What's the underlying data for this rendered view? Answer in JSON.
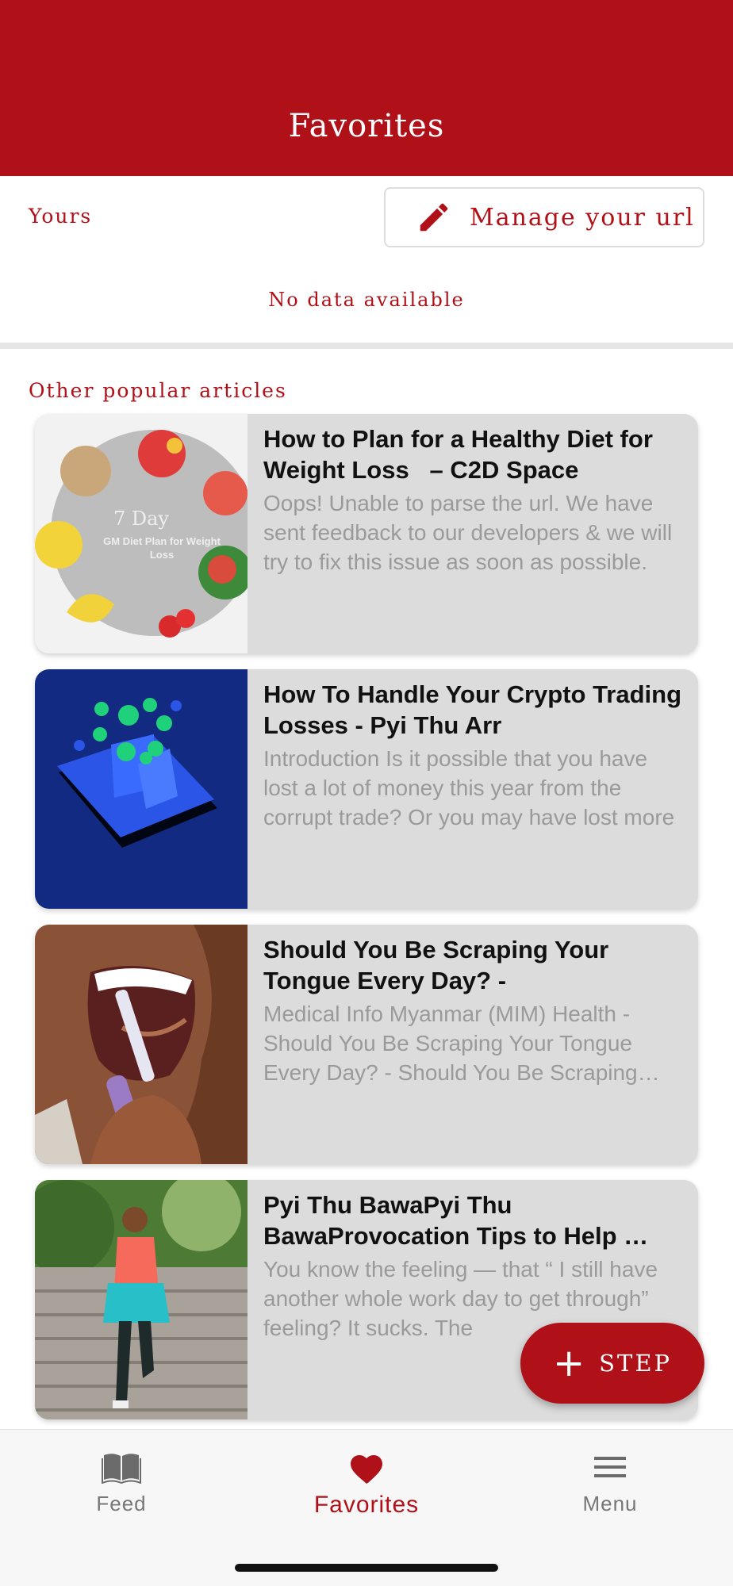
{
  "header": {
    "title": "Favorites"
  },
  "yours": {
    "label": "Yours",
    "manage_label": "Manage your url",
    "empty_text": "No data available"
  },
  "popular": {
    "label": "Other popular articles",
    "articles": [
      {
        "title": "How to Plan for a Healthy Diet for Weight Loss   – C2D Space",
        "description": "Oops! Unable to parse the url. We have sent feedback to our developers & we will try to fix this issue as soon as possible.",
        "thumb_text": "7 Day",
        "thumb_subtext": "GM Diet Plan for Weight Loss"
      },
      {
        "title": "How To Handle Your Crypto Trading Losses - Pyi Thu Arr",
        "description": "Introduction Is it possible that you have lost a lot of money this year from the corrupt trade? Or you may have lost more"
      },
      {
        "title": "Should You Be Scraping Your Tongue Every Day? -",
        "description": "Medical Info Myanmar (MIM) Health - Should You Be Scraping Your Tongue Every Day? - Should You Be Scraping Your Tongue"
      },
      {
        "title": "Pyi Thu BawaPyi Thu BawaProvocation Tips to Help …",
        "description": "You know the feeling — that “ I still have another whole work day to get through” feeling? It sucks. The"
      }
    ]
  },
  "fab": {
    "label": "STEP"
  },
  "tabs": [
    {
      "label": "Feed",
      "icon": "book-icon",
      "active": false
    },
    {
      "label": "Favorites",
      "icon": "heart-icon",
      "active": true
    },
    {
      "label": "Menu",
      "icon": "hamburger-icon",
      "active": false
    }
  ],
  "colors": {
    "brand": "#b01018",
    "card_bg": "#dcdcdc",
    "muted_text": "#9a9a9a"
  }
}
